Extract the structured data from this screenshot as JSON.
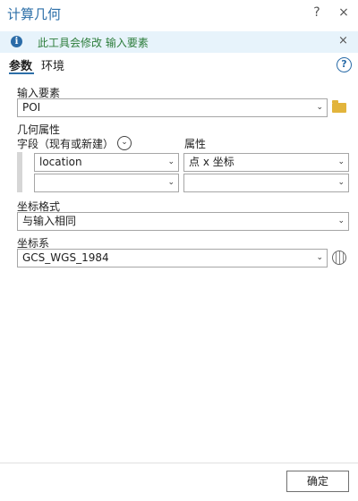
{
  "window": {
    "title": "计算几何",
    "help_label": "?",
    "close_label": "×"
  },
  "info": {
    "message": "此工具会修改 输入要素",
    "icon": "info-icon",
    "close_label": "×"
  },
  "tabs": [
    {
      "label": "参数"
    },
    {
      "label": "环境"
    }
  ],
  "help_icon": "?",
  "input_features": {
    "label": "输入要素",
    "value": "POI"
  },
  "geometry": {
    "section_label": "几何属性",
    "field_header": "字段（现有或新建）",
    "property_header": "属性",
    "expand_icon": "⌄",
    "rows": [
      {
        "field": "location",
        "property": "点 x 坐标"
      },
      {
        "field": "",
        "property": ""
      }
    ]
  },
  "coordinate_format": {
    "label": "坐标格式",
    "value": "与输入相同"
  },
  "coordinate_system": {
    "label": "坐标系",
    "value": "GCS_WGS_1984"
  },
  "footer": {
    "ok_label": "确定"
  },
  "colors": {
    "accent": "#2c6fa8",
    "info_bg": "#e7f3fb",
    "info_text": "#2d7d3b"
  }
}
